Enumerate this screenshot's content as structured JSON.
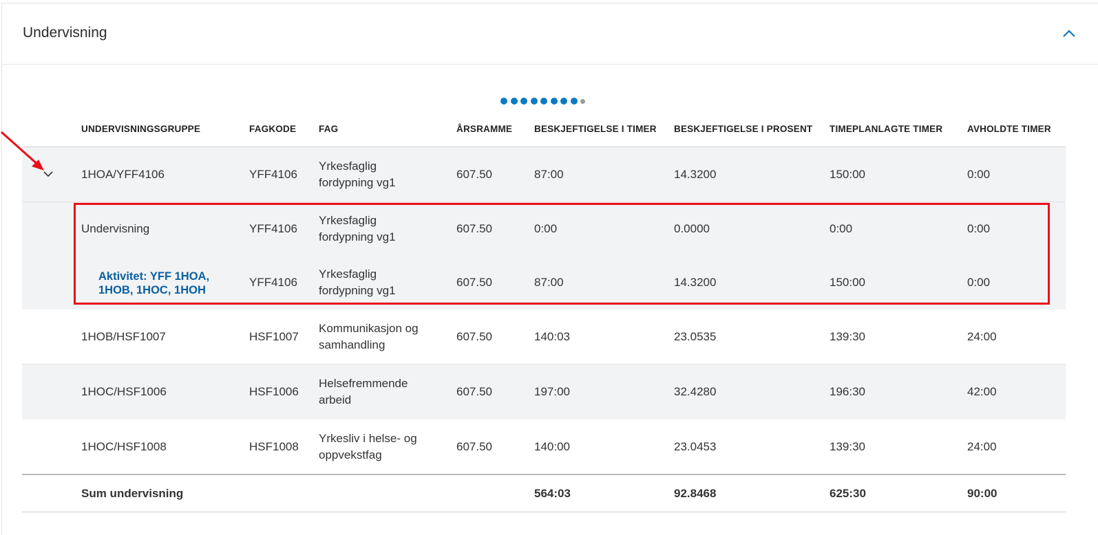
{
  "panel": {
    "title": "Undervisning"
  },
  "pagination": {
    "total_dots": 9,
    "active_dots": 8
  },
  "columns": {
    "group": "UNDERVISNINGSGRUPPE",
    "code": "FAGKODE",
    "subject": "FAG",
    "frame": "ÅRSRAMME",
    "hours": "BESKJEFTIGELSE I TIMER",
    "percent": "BESKJEFTIGELSE I PROSENT",
    "planned": "TIMEPLANLAGTE TIMER",
    "held": "AVHOLDTE TIMER"
  },
  "rows": [
    {
      "group": "1HOA/YFF4106",
      "code": "YFF4106",
      "subject": "Yrkesfaglig fordypning vg1",
      "frame": "607.50",
      "hours": "87:00",
      "percent": "14.3200",
      "planned": "150:00",
      "held": "0:00"
    },
    {
      "group": "Undervisning",
      "code": "YFF4106",
      "subject": "Yrkesfaglig fordypning vg1",
      "frame": "607.50",
      "hours": "0:00",
      "percent": "0.0000",
      "planned": "0:00",
      "held": "0:00"
    },
    {
      "group": "Aktivitet: YFF 1HOA, 1HOB, 1HOC, 1HOH",
      "code": "YFF4106",
      "subject": "Yrkesfaglig fordypning vg1",
      "frame": "607.50",
      "hours": "87:00",
      "percent": "14.3200",
      "planned": "150:00",
      "held": "0:00"
    },
    {
      "group": "1HOB/HSF1007",
      "code": "HSF1007",
      "subject": "Kommunikasjon og samhandling",
      "frame": "607.50",
      "hours": "140:03",
      "percent": "23.0535",
      "planned": "139:30",
      "held": "24:00"
    },
    {
      "group": "1HOC/HSF1006",
      "code": "HSF1006",
      "subject": "Helsefremmende arbeid",
      "frame": "607.50",
      "hours": "197:00",
      "percent": "32.4280",
      "planned": "196:30",
      "held": "42:00"
    },
    {
      "group": "1HOC/HSF1008",
      "code": "HSF1008",
      "subject": "Yrkesliv i helse- og oppvekstfag",
      "frame": "607.50",
      "hours": "140:00",
      "percent": "23.0453",
      "planned": "139:30",
      "held": "24:00"
    }
  ],
  "sum": {
    "label": "Sum undervisning",
    "hours": "564:03",
    "percent": "92.8468",
    "planned": "625:30",
    "held": "90:00"
  },
  "colors": {
    "accent": "#0a7bc2",
    "link": "#0a5fa0",
    "highlight": "#e8101a",
    "row_shade": "#f2f3f5"
  },
  "icons": {
    "collapse": "chevron-up-icon",
    "expand": "chevron-down-icon",
    "annotation": "red-arrow-icon"
  }
}
